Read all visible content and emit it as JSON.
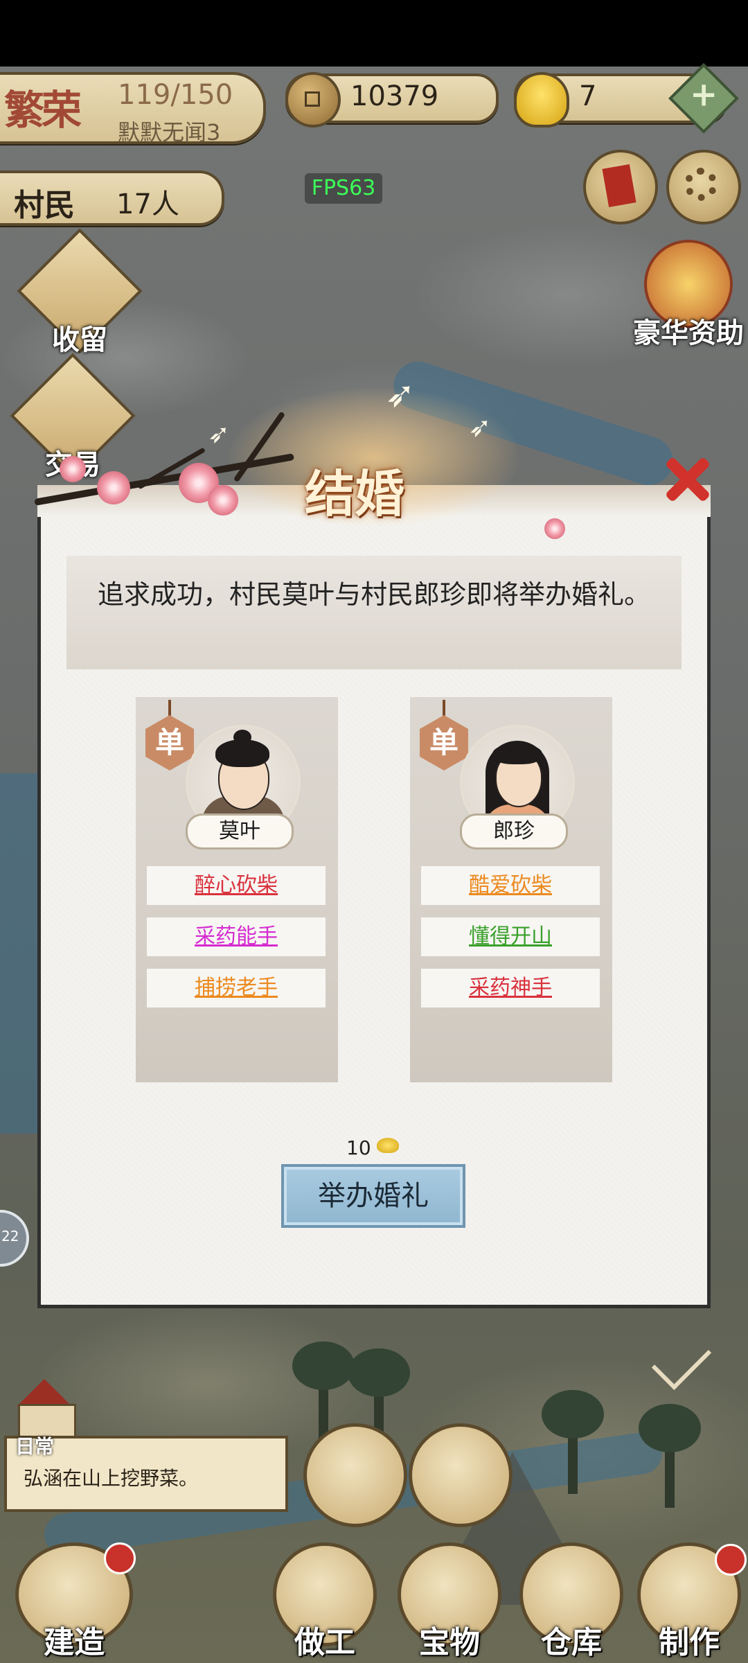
{
  "hud": {
    "prosperity_logo": "繁荣",
    "prosperity_count": "119/150",
    "prosperity_name": "默默无闻3",
    "coins": "10379",
    "ingots": "7",
    "plus": "+",
    "villagers_label": "村民",
    "villagers_count": "17人",
    "fps": "FPS63"
  },
  "side_menu": {
    "shelter": "收留",
    "trade": "交易",
    "sponsor": "豪华资助"
  },
  "dialog": {
    "title": "结婚",
    "message": "追求成功，村民莫叶与村民郎珍即将举办婚礼。",
    "left": {
      "status": "单",
      "name": "莫叶",
      "traits": [
        {
          "label": "醉心砍柴",
          "color": "#d9323d"
        },
        {
          "label": "采药能手",
          "color": "#d52bd0"
        },
        {
          "label": "捕捞老手",
          "color": "#ec8a1f"
        }
      ]
    },
    "right": {
      "status": "单",
      "name": "郎珍",
      "traits": [
        {
          "label": "酷爱砍柴",
          "color": "#ec8a1f"
        },
        {
          "label": "懂得开山",
          "color": "#3aa02b"
        },
        {
          "label": "采药神手",
          "color": "#d9323d"
        }
      ]
    },
    "cost": "10",
    "button": "举办婚礼"
  },
  "bottom": {
    "daily_label": "日常",
    "log": "弘涵在山上挖野菜。",
    "build": "建造",
    "work": "做工",
    "treasure": "宝物",
    "storage": "仓库",
    "craft": "制作",
    "side_circle": "22"
  },
  "colors": {
    "accent_red": "#d1322b",
    "button_blue": "#9fc3db",
    "fps_green": "#3cff57"
  }
}
